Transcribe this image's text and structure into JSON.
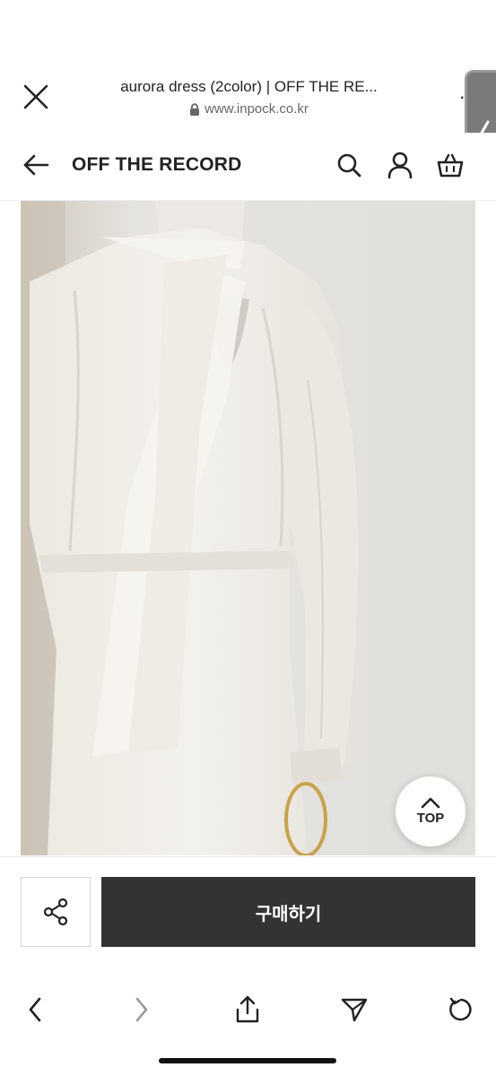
{
  "browser": {
    "page_title": "aurora dress (2color) | OFF THE RE...",
    "url": "www.inpock.co.kr",
    "more_label": "··"
  },
  "site": {
    "store_name": "OFF THE RECORD"
  },
  "product": {
    "top_button_label": "TOP"
  },
  "actions": {
    "buy_label": "구매하기"
  },
  "icons": {
    "close": "close-icon",
    "lock": "lock-icon",
    "back": "arrow-left-icon",
    "search": "search-icon",
    "account": "user-icon",
    "cart": "shopping-basket-icon",
    "side_tab": "chevron-left-icon",
    "top": "chevron-up-icon",
    "share": "share-icon",
    "toolbar_back": "chevron-left-icon",
    "toolbar_forward": "chevron-right-icon",
    "toolbar_share": "share-upload-icon",
    "toolbar_send": "send-icon",
    "toolbar_reload": "reload-icon"
  },
  "colors": {
    "buy_button": "#333333",
    "forward_disabled": "#9a9a9a"
  }
}
